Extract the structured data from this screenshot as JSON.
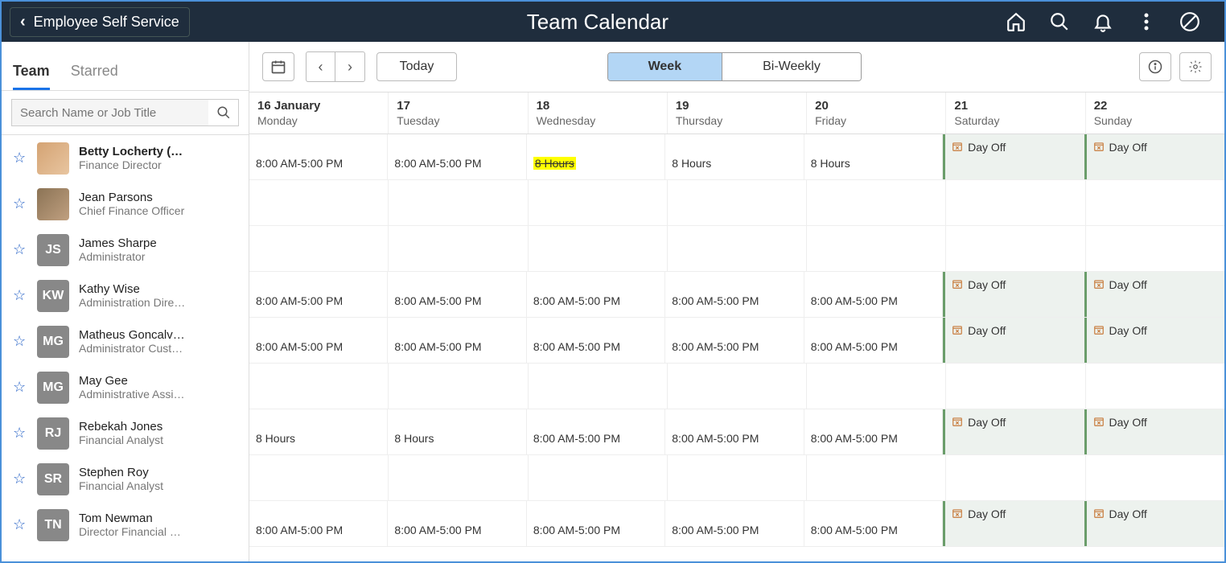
{
  "header": {
    "back_label": "Employee Self Service",
    "title": "Team Calendar"
  },
  "sidebar": {
    "tabs": {
      "team": "Team",
      "starred": "Starred"
    },
    "search_placeholder": "Search Name or Job Title",
    "employees": [
      {
        "initials": "",
        "name": "Betty Locherty (…",
        "title": "Finance Director",
        "bold": true,
        "photo": "photo1"
      },
      {
        "initials": "",
        "name": "Jean Parsons",
        "title": "Chief Finance Officer",
        "bold": false,
        "photo": "photo2"
      },
      {
        "initials": "JS",
        "name": "James Sharpe",
        "title": "Administrator",
        "bold": false,
        "photo": ""
      },
      {
        "initials": "KW",
        "name": "Kathy Wise",
        "title": "Administration Dire…",
        "bold": false,
        "photo": ""
      },
      {
        "initials": "MG",
        "name": "Matheus Goncalv…",
        "title": "Administrator Cust…",
        "bold": false,
        "photo": ""
      },
      {
        "initials": "MG",
        "name": "May Gee",
        "title": "Administrative Assi…",
        "bold": false,
        "photo": ""
      },
      {
        "initials": "RJ",
        "name": "Rebekah Jones",
        "title": "Financial Analyst",
        "bold": false,
        "photo": ""
      },
      {
        "initials": "SR",
        "name": "Stephen Roy",
        "title": "Financial Analyst",
        "bold": false,
        "photo": ""
      },
      {
        "initials": "TN",
        "name": "Tom Newman",
        "title": "Director Financial …",
        "bold": false,
        "photo": ""
      }
    ]
  },
  "toolbar": {
    "today": "Today",
    "seg": {
      "week": "Week",
      "biweekly": "Bi-Weekly"
    }
  },
  "days": [
    {
      "num": "16 January",
      "dow": "Monday"
    },
    {
      "num": "17",
      "dow": "Tuesday"
    },
    {
      "num": "18",
      "dow": "Wednesday"
    },
    {
      "num": "19",
      "dow": "Thursday"
    },
    {
      "num": "20",
      "dow": "Friday"
    },
    {
      "num": "21",
      "dow": "Saturday"
    },
    {
      "num": "22",
      "dow": "Sunday"
    }
  ],
  "labels": {
    "day_off": "Day Off",
    "shift_full": "8:00 AM-5:00 PM",
    "hours_8": "8 Hours"
  },
  "schedule": [
    [
      [
        "t",
        "shift_full"
      ],
      [
        "t",
        "shift_full"
      ],
      [
        "h",
        "hours_8"
      ],
      [
        "t",
        "hours_8"
      ],
      [
        "t",
        "hours_8"
      ],
      [
        "d"
      ],
      [
        "d"
      ]
    ],
    [
      [
        "e"
      ],
      [
        "e"
      ],
      [
        "e"
      ],
      [
        "e"
      ],
      [
        "e"
      ],
      [
        "e"
      ],
      [
        "e"
      ]
    ],
    [
      [
        "e"
      ],
      [
        "e"
      ],
      [
        "e"
      ],
      [
        "e"
      ],
      [
        "e"
      ],
      [
        "e"
      ],
      [
        "e"
      ]
    ],
    [
      [
        "t",
        "shift_full"
      ],
      [
        "t",
        "shift_full"
      ],
      [
        "t",
        "shift_full"
      ],
      [
        "t",
        "shift_full"
      ],
      [
        "t",
        "shift_full"
      ],
      [
        "d"
      ],
      [
        "d"
      ]
    ],
    [
      [
        "t",
        "shift_full"
      ],
      [
        "t",
        "shift_full"
      ],
      [
        "t",
        "shift_full"
      ],
      [
        "t",
        "shift_full"
      ],
      [
        "t",
        "shift_full"
      ],
      [
        "d"
      ],
      [
        "d"
      ]
    ],
    [
      [
        "e"
      ],
      [
        "e"
      ],
      [
        "e"
      ],
      [
        "e"
      ],
      [
        "e"
      ],
      [
        "e"
      ],
      [
        "e"
      ]
    ],
    [
      [
        "t",
        "hours_8"
      ],
      [
        "t",
        "hours_8"
      ],
      [
        "t",
        "shift_full"
      ],
      [
        "t",
        "shift_full"
      ],
      [
        "t",
        "shift_full"
      ],
      [
        "d"
      ],
      [
        "d"
      ]
    ],
    [
      [
        "e"
      ],
      [
        "e"
      ],
      [
        "e"
      ],
      [
        "e"
      ],
      [
        "e"
      ],
      [
        "e"
      ],
      [
        "e"
      ]
    ],
    [
      [
        "t",
        "shift_full"
      ],
      [
        "t",
        "shift_full"
      ],
      [
        "t",
        "shift_full"
      ],
      [
        "t",
        "shift_full"
      ],
      [
        "t",
        "shift_full"
      ],
      [
        "d"
      ],
      [
        "d"
      ]
    ]
  ]
}
